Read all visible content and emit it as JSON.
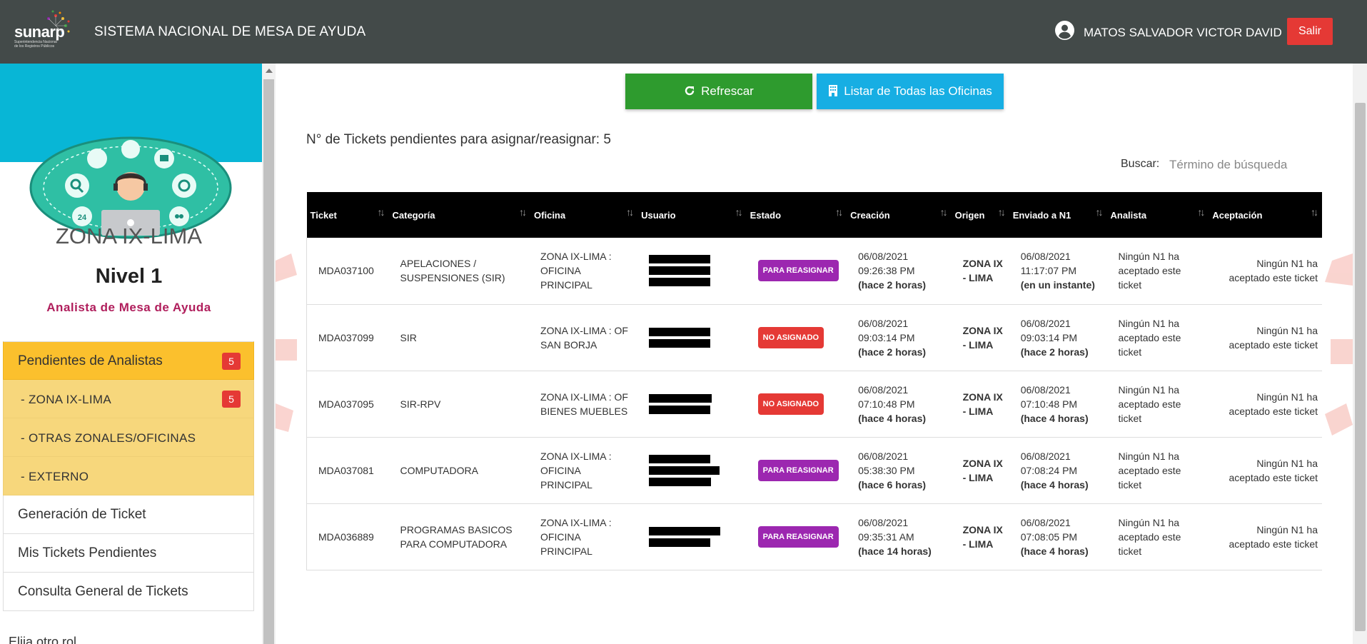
{
  "header": {
    "logo_text": "sunarp",
    "logo_subtext": "Superintendencia Nacional de los Registros Públicos",
    "app_title": "SISTEMA NACIONAL DE MESA DE AYUDA",
    "user_name": "MATOS SALVADOR VICTOR DAVID",
    "logout_label": "Salir",
    "user_icon": "account-circle-icon"
  },
  "sidebar": {
    "zone": "ZONA IX-LIMA",
    "level": "Nivel 1",
    "role": "Analista de Mesa de Ayuda",
    "menu": [
      {
        "label": "Pendientes de Analistas",
        "badge": "5"
      },
      {
        "label": "- ZONA IX-LIMA",
        "badge": "5"
      },
      {
        "label": "- OTRAS ZONALES/OFICINAS"
      },
      {
        "label": "- EXTERNO"
      },
      {
        "label": "Generación de Ticket"
      },
      {
        "label": "Mis Tickets Pendientes"
      },
      {
        "label": "Consulta General de Tickets"
      }
    ],
    "other_role": "Elija otro rol"
  },
  "toolbar": {
    "refresh_label": "Refrescar",
    "refresh_icon": "refresh-icon",
    "list_offices_label": "Listar de Todas las Oficinas",
    "list_offices_icon": "building-icon"
  },
  "summary": {
    "pending_text": "N° de Tickets pendientes para asignar/reasignar: 5"
  },
  "search": {
    "label": "Buscar:",
    "placeholder": "Término de búsqueda"
  },
  "table": {
    "columns": [
      "Ticket",
      "Categoría",
      "Oficina",
      "Usuario",
      "Estado",
      "Creación",
      "Origen",
      "Enviado a N1",
      "Analista",
      "Aceptación"
    ],
    "rows": [
      {
        "ticket": "MDA037100",
        "category": "APELACIONES / SUSPENSIONES (SIR)",
        "office": "ZONA IX-LIMA : OFICINA PRINCIPAL",
        "status": "PARA REASIGNAR",
        "created_date": "06/08/2021",
        "created_time": "09:26:38 PM",
        "created_ago": "(hace 2 horas)",
        "origin": "ZONA IX - LIMA",
        "sent_date": "06/08/2021",
        "sent_time": "11:17:07 PM",
        "sent_ago": "(en un instante)",
        "analyst": "Ningún N1 ha aceptado este ticket",
        "acceptance": "Ningún N1 ha aceptado este ticket"
      },
      {
        "ticket": "MDA037099",
        "category": "SIR",
        "office": "ZONA IX-LIMA : OF SAN BORJA",
        "status": "NO ASIGNADO",
        "created_date": "06/08/2021",
        "created_time": "09:03:14 PM",
        "created_ago": "(hace 2 horas)",
        "origin": "ZONA IX - LIMA",
        "sent_date": "06/08/2021",
        "sent_time": "09:03:14 PM",
        "sent_ago": "(hace 2 horas)",
        "analyst": "Ningún N1 ha aceptado este ticket",
        "acceptance": "Ningún N1 ha aceptado este ticket"
      },
      {
        "ticket": "MDA037095",
        "category": "SIR-RPV",
        "office": "ZONA IX-LIMA : OF BIENES MUEBLES",
        "status": "NO ASIGNADO",
        "created_date": "06/08/2021",
        "created_time": "07:10:48 PM",
        "created_ago": "(hace 4 horas)",
        "origin": "ZONA IX - LIMA",
        "sent_date": "06/08/2021",
        "sent_time": "07:10:48 PM",
        "sent_ago": "(hace 4 horas)",
        "analyst": "Ningún N1 ha aceptado este ticket",
        "acceptance": "Ningún N1 ha aceptado este ticket"
      },
      {
        "ticket": "MDA037081",
        "category": "COMPUTADORA",
        "office": "ZONA IX-LIMA : OFICINA PRINCIPAL",
        "status": "PARA REASIGNAR",
        "created_date": "06/08/2021",
        "created_time": "05:38:30 PM",
        "created_ago": "(hace 6 horas)",
        "origin": "ZONA IX - LIMA",
        "sent_date": "06/08/2021",
        "sent_time": "07:08:24 PM",
        "sent_ago": "(hace 4 horas)",
        "analyst": "Ningún N1 ha aceptado este ticket",
        "acceptance": "Ningún N1 ha aceptado este ticket"
      },
      {
        "ticket": "MDA036889",
        "category": "PROGRAMAS BASICOS PARA COMPUTADORA",
        "office": "ZONA IX-LIMA : OFICINA PRINCIPAL",
        "status": "PARA REASIGNAR",
        "created_date": "06/08/2021",
        "created_time": "09:35:31 AM",
        "created_ago": "(hace 14 horas)",
        "origin": "ZONA IX - LIMA",
        "sent_date": "06/08/2021",
        "sent_time": "07:08:05 PM",
        "sent_ago": "(hace 4 horas)",
        "analyst": "Ningún N1 ha aceptado este ticket",
        "acceptance": "Ningún N1 ha aceptado este ticket"
      }
    ]
  },
  "colors": {
    "header_bg": "#434a49",
    "banner_bg": "#08b6d6",
    "menu_active": "#fbc02d",
    "menu_sub": "#f7d77c",
    "badge": "#e53935",
    "refresh_btn": "#2e9b2e",
    "offices_btn": "#17aee3",
    "status_reassign": "#9c27b0",
    "status_unassigned": "#e53935",
    "date_text": "#1a5fd6",
    "origin_text": "#5a2bd6",
    "warning_text": "#e53935"
  }
}
